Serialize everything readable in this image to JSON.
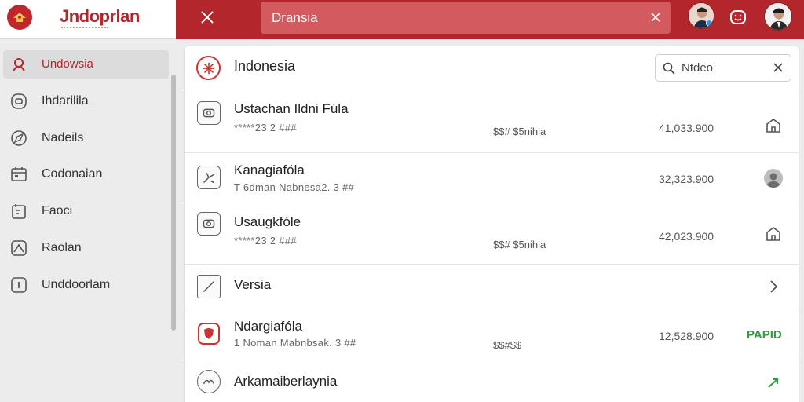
{
  "app": {
    "title": "Jndoprlan",
    "brand_color": "#b3262b"
  },
  "topbar": {
    "search_value": "Dransia",
    "close_icon": "close-icon",
    "clear_icon": "clear-icon",
    "emoji_icon": "smiley-icon"
  },
  "sidebar": {
    "items": [
      {
        "label": "Undowsia",
        "icon": "pin-icon",
        "active": true
      },
      {
        "label": "Ihdarilila",
        "icon": "badge-icon",
        "active": false
      },
      {
        "label": "Nadeils",
        "icon": "compass-icon",
        "active": false
      },
      {
        "label": "Codonaian",
        "icon": "calendar-icon",
        "active": false
      },
      {
        "label": "Faoci",
        "icon": "document-icon",
        "active": false
      },
      {
        "label": "Raolan",
        "icon": "mountain-icon",
        "active": false
      },
      {
        "label": "Unddoorlam",
        "icon": "square-icon",
        "active": false
      }
    ]
  },
  "main": {
    "header": {
      "title": "Indonesia",
      "filter_value": "Ntdeo"
    },
    "rows": [
      {
        "title": "Ustachan Ildni Fúla",
        "sub": "*****23 2 ###",
        "mid": "$$# $5nihia",
        "amount": "41,033.900",
        "action": "home-icon"
      },
      {
        "title": "Kanagiafóla",
        "sub": "T 6dman Nabnesa2. 3 ##",
        "mid": "",
        "amount": "32,323.900",
        "action": "user-avatar-icon"
      },
      {
        "title": "Usaugkfóle",
        "sub": "*****23 2 ###",
        "mid": "$$# $5nihia",
        "amount": "42,023.900",
        "action": "home-icon"
      },
      {
        "title": "Versia",
        "sub": "",
        "mid": "",
        "amount": "",
        "action": "chevron-right-icon"
      },
      {
        "title": "Ndargiafóla",
        "sub": "1 Noman Mabnbsak. 3 ##",
        "mid": "$$#$$",
        "amount": "12,528.900",
        "status": "PAPID"
      },
      {
        "title": "Arkamaiberlaynia",
        "sub": "",
        "mid": "",
        "amount": "",
        "action": "arrow-icon"
      }
    ]
  },
  "colors": {
    "accent": "#b3262b",
    "paid": "#2f9a48"
  }
}
